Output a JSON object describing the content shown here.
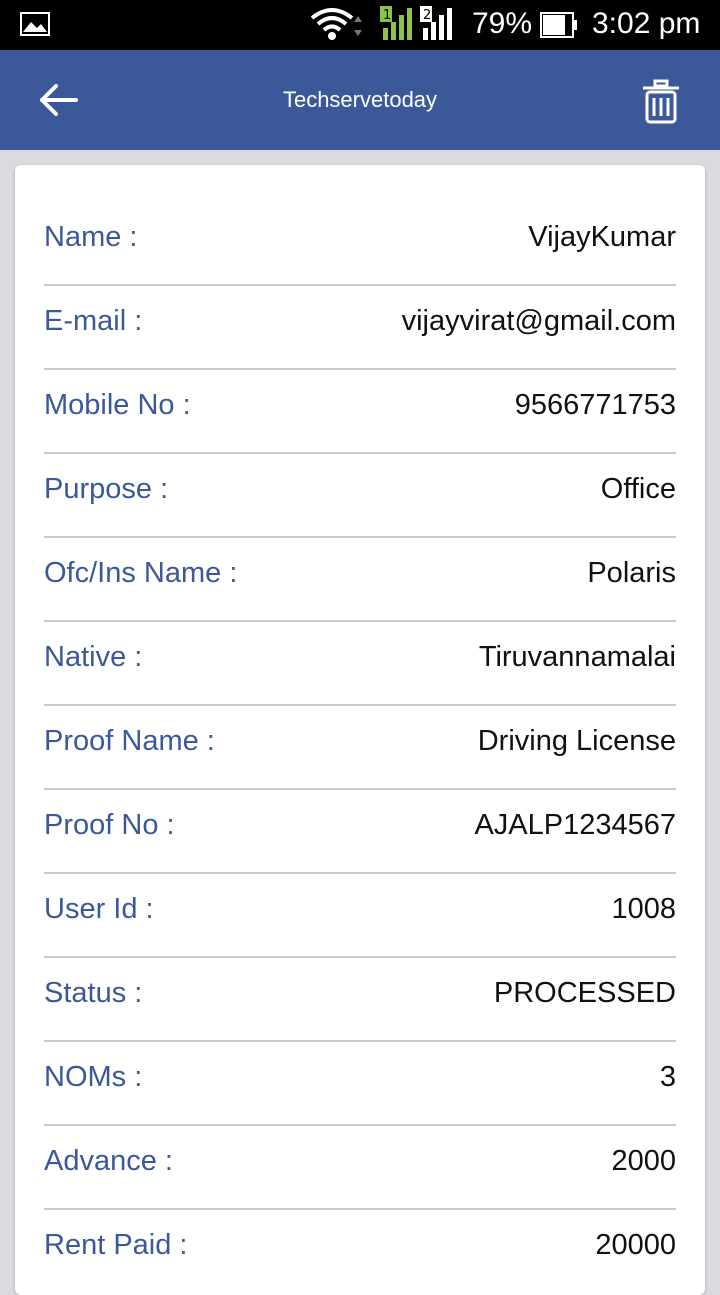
{
  "status_bar": {
    "battery_percent": "79%",
    "time": "3:02 pm",
    "sim1": "1",
    "sim2": "2"
  },
  "app_bar": {
    "title": "Techservetoday",
    "back_icon": "arrow-left",
    "delete_icon": "trash"
  },
  "details": [
    {
      "label": "Name :",
      "value": "VijayKumar"
    },
    {
      "label": "E-mail :",
      "value": "vijayvirat@gmail.com"
    },
    {
      "label": "Mobile No :",
      "value": "9566771753"
    },
    {
      "label": "Purpose :",
      "value": "Office"
    },
    {
      "label": "Ofc/Ins Name :",
      "value": "Polaris"
    },
    {
      "label": "Native :",
      "value": "Tiruvannamalai"
    },
    {
      "label": "Proof Name :",
      "value": "Driving License"
    },
    {
      "label": "Proof No :",
      "value": "AJALP1234567"
    },
    {
      "label": "User Id :",
      "value": "1008"
    },
    {
      "label": "Status :",
      "value": "PROCESSED"
    },
    {
      "label": "NOMs :",
      "value": "3"
    },
    {
      "label": "Advance :",
      "value": "2000"
    },
    {
      "label": "Rent Paid :",
      "value": "20000"
    }
  ],
  "colors": {
    "primary": "#3b5999",
    "label": "#3b5999",
    "value": "#111111",
    "background": "#d9dbe0"
  }
}
